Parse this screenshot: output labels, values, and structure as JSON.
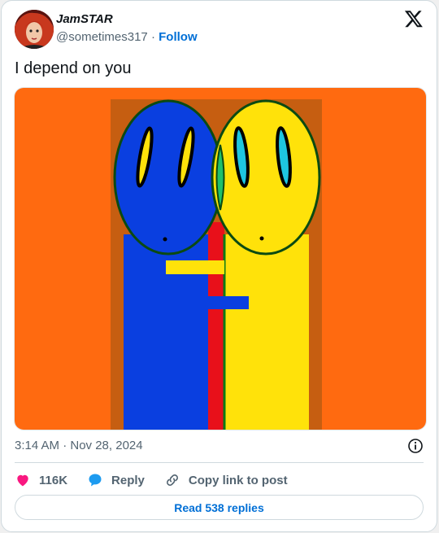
{
  "author": {
    "name": "JamSTAR",
    "handle": "@sometimes317",
    "separator": "·",
    "follow_label": "Follow"
  },
  "tweet": {
    "text": "I depend on you",
    "image": {
      "accent_colors": [
        "#ff6a10",
        "#0a3fe0",
        "#ffe20a",
        "#e8101a"
      ]
    },
    "timestamp": "3:14 AM · Nov 28, 2024"
  },
  "actions": {
    "likes": "116K",
    "reply_label": "Reply",
    "copy_label": "Copy link to post"
  },
  "read_replies_label": "Read 538 replies",
  "colors": {
    "link": "#006fd6",
    "like": "#f91880",
    "reply": "#1d9bf0"
  }
}
